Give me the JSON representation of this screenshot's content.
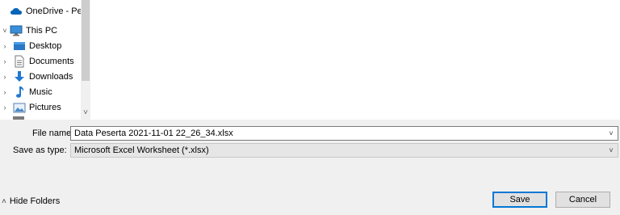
{
  "nav": {
    "items": [
      {
        "label": "OneDrive - Persor",
        "icon": "onedrive-cloud-icon",
        "chevron": ""
      },
      {
        "label": "This PC",
        "icon": "this-pc-icon",
        "chevron": "˅"
      },
      {
        "label": "Desktop",
        "icon": "desktop-icon",
        "chevron": "›"
      },
      {
        "label": "Documents",
        "icon": "documents-icon",
        "chevron": "›"
      },
      {
        "label": "Downloads",
        "icon": "downloads-icon",
        "chevron": "›"
      },
      {
        "label": "Music",
        "icon": "music-icon",
        "chevron": "›"
      },
      {
        "label": "Pictures",
        "icon": "pictures-icon",
        "chevron": "›"
      }
    ]
  },
  "form": {
    "file_name_label": "File name:",
    "file_name_value": "Data Peserta 2021-11-01 22_26_34.xlsx",
    "save_as_type_label": "Save as type:",
    "save_as_type_value": "Microsoft Excel Worksheet (*.xlsx)"
  },
  "footer": {
    "hide_folders_label": "Hide Folders",
    "save_label": "Save",
    "cancel_label": "Cancel"
  },
  "colors": {
    "accent": "#0078d7",
    "onedrive": "#0364b8"
  }
}
